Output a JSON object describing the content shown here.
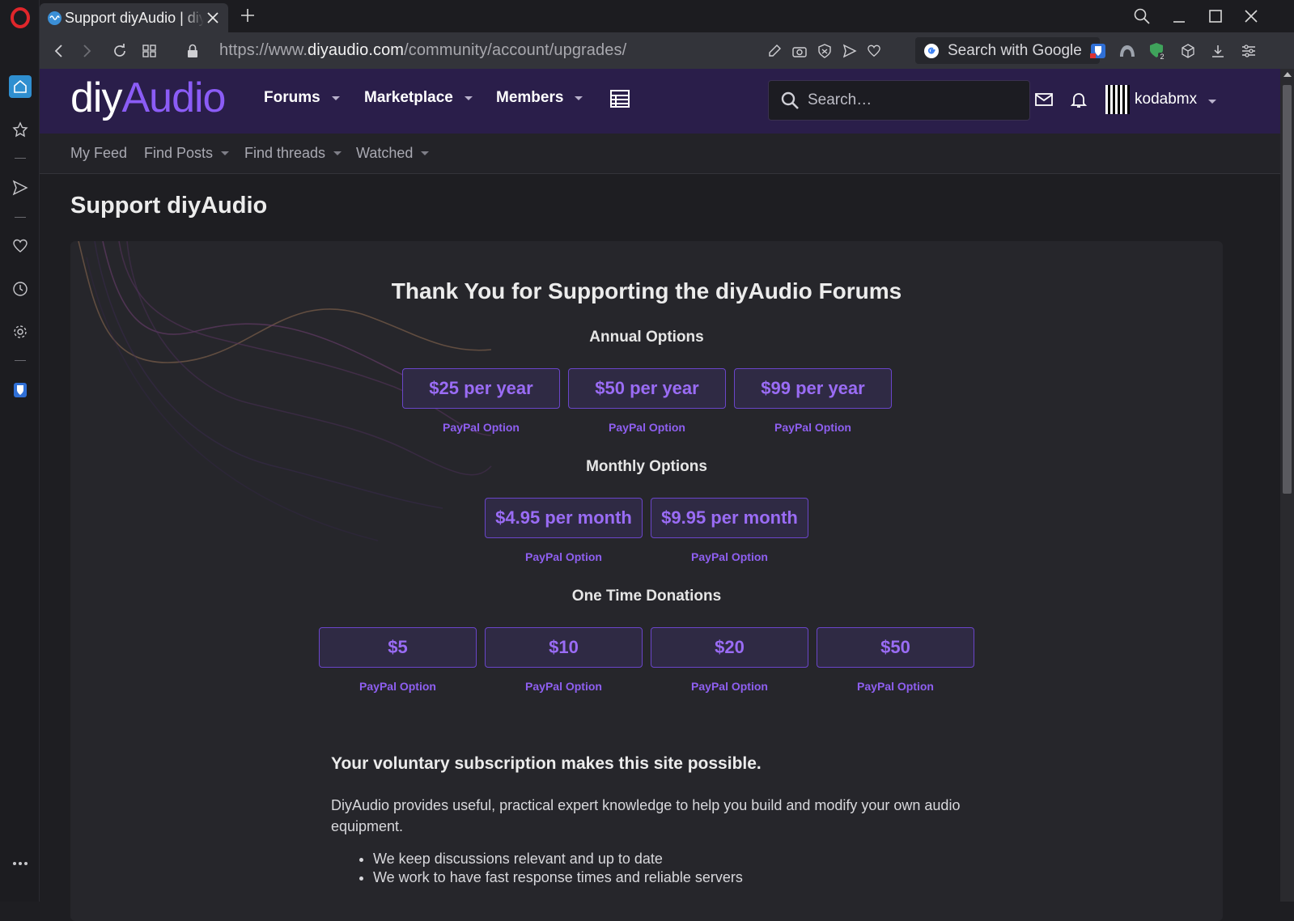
{
  "browser": {
    "tab_title": "Support diyAudio | diyAudio",
    "url_prefix": "https://www.",
    "url_domain": "diyaudio.com",
    "url_path": "/community/account/upgrades/",
    "search_engine_label": "Search with Google",
    "extension_badge": "2"
  },
  "site": {
    "logo_diy": "diy",
    "logo_audio": "Audio",
    "nav": [
      {
        "label": "Forums"
      },
      {
        "label": "Marketplace"
      },
      {
        "label": "Members"
      }
    ],
    "search_placeholder": "Search…",
    "username": "kodabmx",
    "subnav": [
      {
        "label": "My Feed"
      },
      {
        "label": "Find Posts"
      },
      {
        "label": "Find threads"
      },
      {
        "label": "Watched"
      }
    ]
  },
  "page": {
    "title": "Support diyAudio",
    "panel_title": "Thank You for Supporting the diyAudio Forums",
    "annual": {
      "label": "Annual Options",
      "options": [
        "$25 per year",
        "$50 per year",
        "$99 per year"
      ]
    },
    "monthly": {
      "label": "Monthly Options",
      "options": [
        "$4.95 per month",
        "$9.95 per month"
      ]
    },
    "onetime": {
      "label": "One Time Donations",
      "options": [
        "$5",
        "$10",
        "$20",
        "$50"
      ]
    },
    "paypal_label": "PayPal Option",
    "subheading": "Your voluntary subscription makes this site possible.",
    "paragraph": "DiyAudio provides useful, practical expert knowledge to help you build and modify your own audio equipment.",
    "bullets": [
      "We keep discussions relevant and up to date",
      "We work to have fast response times and reliable servers"
    ]
  },
  "colors": {
    "accent": "#8b5cf6",
    "header_bg": "#2a1e4a",
    "panel_bg": "#26262b"
  }
}
